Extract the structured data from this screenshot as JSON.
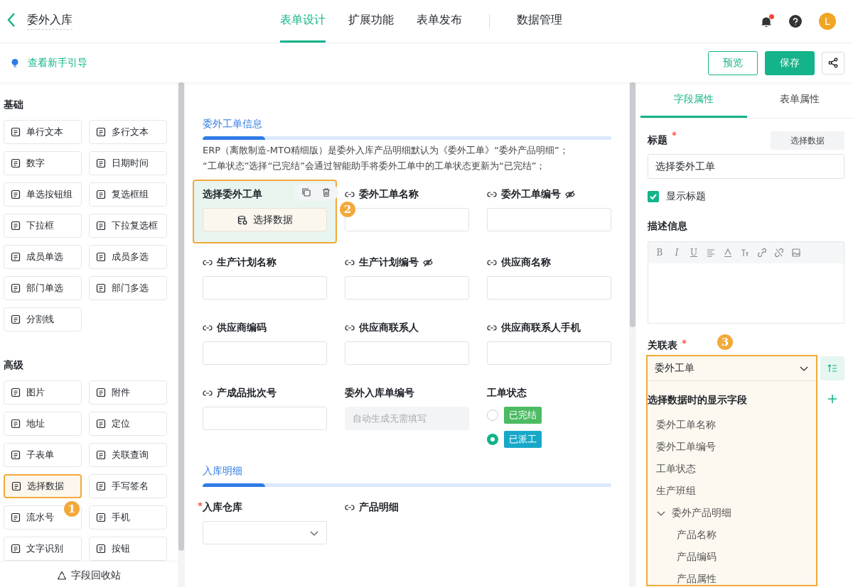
{
  "header": {
    "title": "委外入库",
    "tabs": [
      {
        "label": "表单设计",
        "selected": true
      },
      {
        "label": "扩展功能",
        "selected": false
      },
      {
        "label": "表单发布",
        "selected": false
      },
      {
        "label": "数据管理",
        "selected": false
      }
    ],
    "notification_dot": true,
    "avatar": "L"
  },
  "toolbar": {
    "guide_link": "查看新手引导",
    "buttons": [
      {
        "label": "预览",
        "kind": "outline"
      },
      {
        "label": "保存",
        "kind": "primary"
      }
    ]
  },
  "palette": {
    "sections": [
      {
        "title": "基础",
        "items": [
          {
            "label": "单行文本",
            "selected": false
          },
          {
            "label": "多行文本",
            "selected": false
          },
          {
            "label": "数字",
            "selected": false
          },
          {
            "label": "日期时间",
            "selected": false
          },
          {
            "label": "单选按钮组",
            "selected": false
          },
          {
            "label": "复选框组",
            "selected": false
          },
          {
            "label": "下拉框",
            "selected": false
          },
          {
            "label": "下拉复选框",
            "selected": false
          },
          {
            "label": "成员单选",
            "selected": false
          },
          {
            "label": "成员多选",
            "selected": false
          },
          {
            "label": "部门单选",
            "selected": false
          },
          {
            "label": "部门多选",
            "selected": false
          },
          {
            "label": "分割线",
            "selected": false
          }
        ]
      },
      {
        "title": "高级",
        "items": [
          {
            "label": "图片",
            "selected": false
          },
          {
            "label": "附件",
            "selected": false
          },
          {
            "label": "地址",
            "selected": false
          },
          {
            "label": "定位",
            "selected": false
          },
          {
            "label": "子表单",
            "selected": false
          },
          {
            "label": "关联查询",
            "selected": false
          },
          {
            "label": "选择数据",
            "selected": true
          },
          {
            "label": "手写签名",
            "selected": false
          },
          {
            "label": "流水号",
            "selected": false
          },
          {
            "label": "手机",
            "selected": false
          },
          {
            "label": "文字识别",
            "selected": false
          },
          {
            "label": "按钮",
            "selected": false
          }
        ]
      }
    ],
    "recycle_bin": "字段回收站"
  },
  "canvas": {
    "sections": [
      {
        "title": "委外工单信息",
        "notes": [
          "ERP（离散制造-MTO精细版）是委外入库产品明细默认为《委外工单》“委外产品明细”；",
          "“工单状态”选择“已完结”会通过智能助手将委外工单中的工单状态更新为“已完结”；"
        ],
        "fields": [
          {
            "label": "选择委外工单",
            "kind": "select_data",
            "button": "选择数据",
            "selected": true,
            "linked": false,
            "hidden": false,
            "required": false
          },
          {
            "label": "委外工单名称",
            "kind": "input",
            "selected": false,
            "linked": true,
            "hidden": false,
            "required": false
          },
          {
            "label": "委外工单编号",
            "kind": "input",
            "selected": false,
            "linked": true,
            "hidden": true,
            "required": false
          },
          {
            "label": "生产计划名称",
            "kind": "input",
            "selected": false,
            "linked": true,
            "hidden": false,
            "required": false
          },
          {
            "label": "生产计划编号",
            "kind": "input",
            "selected": false,
            "linked": true,
            "hidden": true,
            "required": false
          },
          {
            "label": "供应商名称",
            "kind": "input",
            "selected": false,
            "linked": true,
            "hidden": false,
            "required": false
          },
          {
            "label": "供应商编码",
            "kind": "input",
            "selected": false,
            "linked": true,
            "hidden": false,
            "required": false
          },
          {
            "label": "供应商联系人",
            "kind": "input",
            "selected": false,
            "linked": true,
            "hidden": false,
            "required": false
          },
          {
            "label": "供应商联系人手机",
            "kind": "input",
            "selected": false,
            "linked": true,
            "hidden": false,
            "required": false
          },
          {
            "label": "产成品批次号",
            "kind": "input",
            "selected": false,
            "linked": true,
            "hidden": false,
            "required": false
          },
          {
            "label": "委外入库单编号",
            "kind": "readonly",
            "placeholder": "自动生成无需填写",
            "selected": false,
            "linked": false,
            "hidden": false,
            "required": false
          },
          {
            "label": "工单状态",
            "kind": "radio",
            "options": [
              {
                "label": "已完结",
                "color": "#4cbb62",
                "selected": false
              },
              {
                "label": "已派工",
                "color": "#17a8c9",
                "selected": true
              }
            ],
            "selected": false,
            "linked": false,
            "hidden": false,
            "required": false
          }
        ]
      },
      {
        "title": "入库明细",
        "fields": [
          {
            "label": "入库仓库",
            "kind": "dropdown",
            "selected": false,
            "linked": false,
            "hidden": false,
            "required": true
          },
          {
            "label": "产品明细",
            "kind": "label_only",
            "selected": false,
            "linked": true,
            "hidden": false,
            "required": false
          }
        ]
      }
    ]
  },
  "properties": {
    "tabs": [
      {
        "label": "字段属性",
        "selected": true
      },
      {
        "label": "表单属性",
        "selected": false
      }
    ],
    "title_label": "标题",
    "title_required": true,
    "title_button": "选择数据",
    "title_value": "选择委外工单",
    "show_title": {
      "label": "显示标题",
      "checked": true
    },
    "description_label": "描述信息",
    "editor_text_buttons": [
      "B",
      "I",
      "U"
    ],
    "related_label": "关联表",
    "related_required": true,
    "related_value": "委外工单",
    "display_fields_label": "选择数据时的显示字段",
    "display_fields": [
      {
        "label": "委外工单名称"
      },
      {
        "label": "委外工单编号"
      },
      {
        "label": "工单状态"
      },
      {
        "label": "生产班组"
      },
      {
        "label": "委外产品明细",
        "expanded": true,
        "children": [
          {
            "label": "产品名称"
          },
          {
            "label": "产品编码"
          },
          {
            "label": "产品属性"
          }
        ]
      }
    ]
  },
  "annotations": [
    "1",
    "2",
    "3"
  ]
}
